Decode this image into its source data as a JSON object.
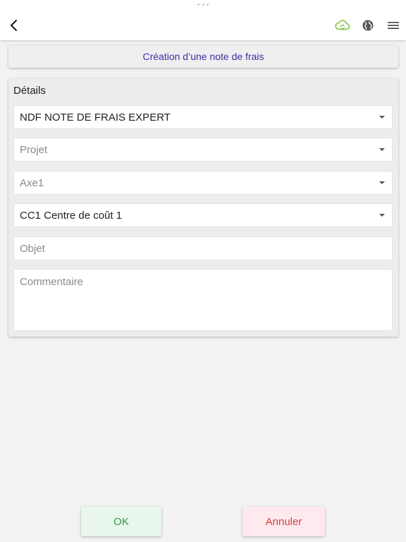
{
  "header": {
    "back_icon": "chevron-left-icon",
    "sync_icon": "cloud-sync-icon",
    "sync_color": "#7cc242",
    "language_icon": "globe-icon",
    "menu_icon": "hamburger-menu-icon"
  },
  "page_title": "Création d’une note de frais",
  "details": {
    "heading": "Détails",
    "type_select": {
      "value": "NDF NOTE DE FRAIS EXPERT"
    },
    "projet_select": {
      "placeholder": "Projet"
    },
    "axe1_select": {
      "placeholder": "Axe1"
    },
    "cost_center_select": {
      "value": "CC1 Centre de coût 1"
    },
    "objet_input": {
      "placeholder": "Objet"
    },
    "commentaire_input": {
      "placeholder": "Commentaire"
    }
  },
  "actions": {
    "ok_label": "OK",
    "cancel_label": "Annuler"
  },
  "colors": {
    "title_text": "#3a2fa8",
    "ok_bg": "#e8f6ee",
    "ok_text": "#3a9a4a",
    "cancel_bg": "#fde9ee",
    "cancel_text": "#d0453c"
  }
}
